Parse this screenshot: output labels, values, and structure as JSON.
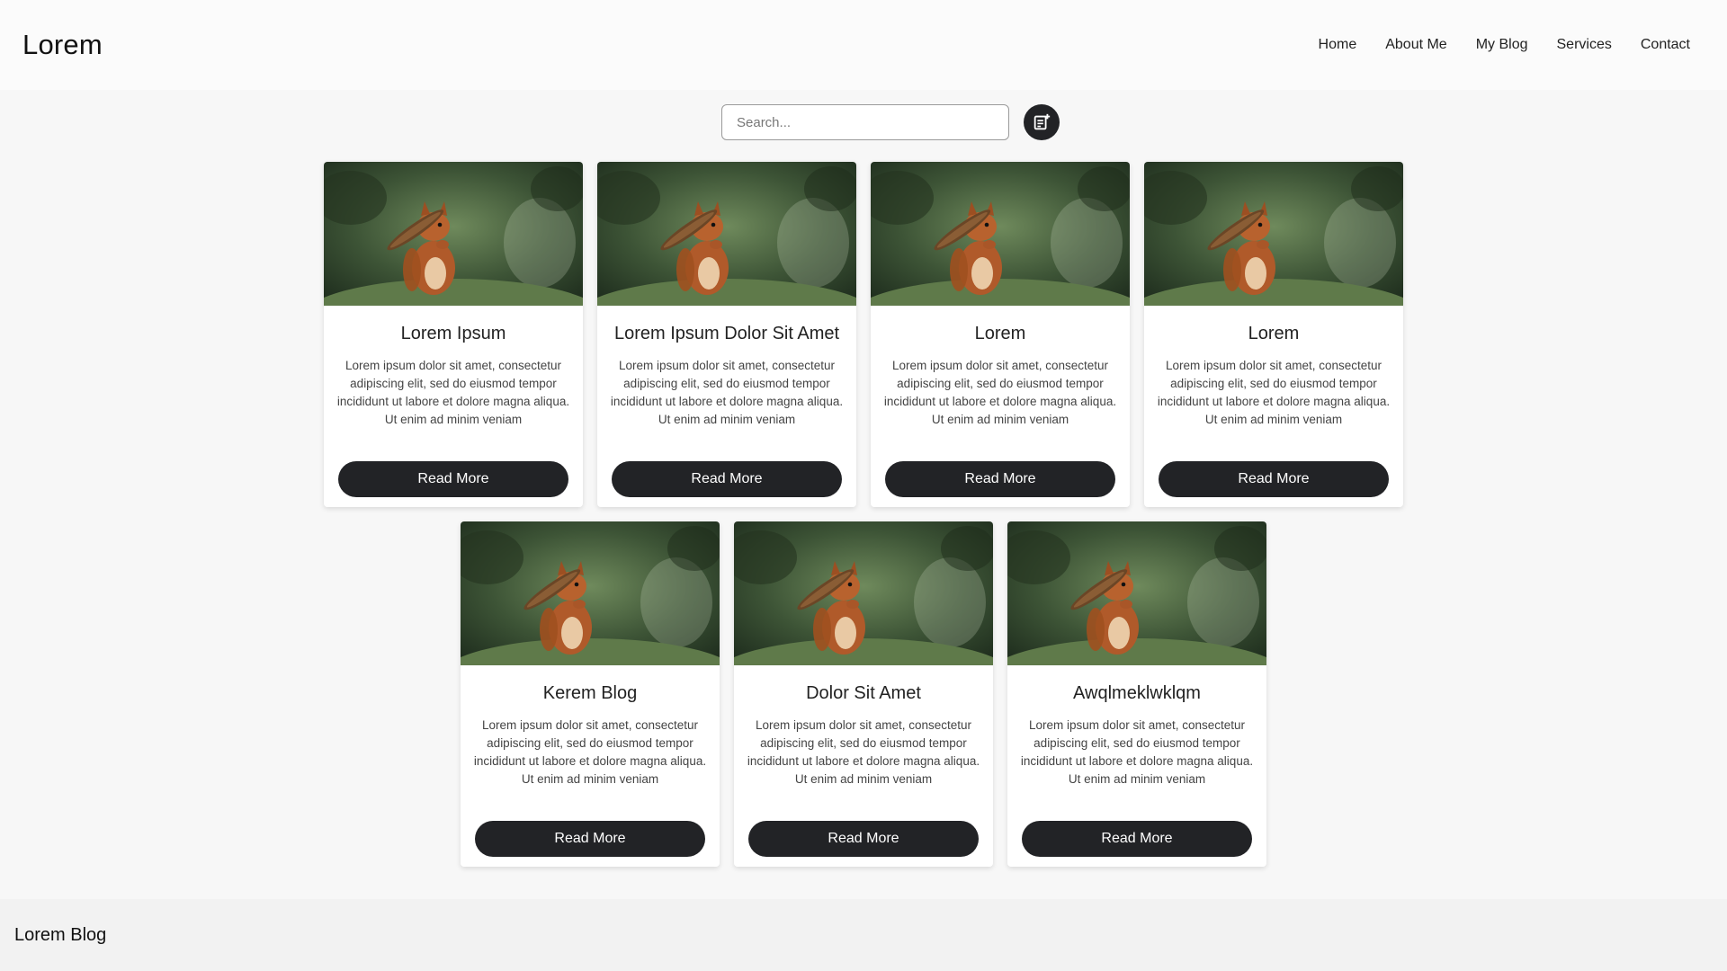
{
  "header": {
    "brand": "Lorem",
    "nav": [
      {
        "label": "Home"
      },
      {
        "label": "About Me"
      },
      {
        "label": "My Blog"
      },
      {
        "label": "Services"
      },
      {
        "label": "Contact"
      }
    ]
  },
  "search": {
    "placeholder": "Search...",
    "value": "",
    "add_icon": "add-note-icon"
  },
  "cards": [
    {
      "title": "Lorem Ipsum",
      "text": "Lorem ipsum dolor sit amet, consectetur adipiscing elit, sed do eiusmod tempor incididunt ut labore et dolore magna aliqua. Ut enim ad minim veniam",
      "button": "Read More"
    },
    {
      "title": "Lorem Ipsum Dolor Sit Amet",
      "text": "Lorem ipsum dolor sit amet, consectetur adipiscing elit, sed do eiusmod tempor incididunt ut labore et dolore magna aliqua. Ut enim ad minim veniam",
      "button": "Read More"
    },
    {
      "title": "Lorem",
      "text": "Lorem ipsum dolor sit amet, consectetur adipiscing elit, sed do eiusmod tempor incididunt ut labore et dolore magna aliqua. Ut enim ad minim veniam",
      "button": "Read More"
    },
    {
      "title": "Lorem",
      "text": "Lorem ipsum dolor sit amet, consectetur adipiscing elit, sed do eiusmod tempor incididunt ut labore et dolore magna aliqua. Ut enim ad minim veniam",
      "button": "Read More"
    },
    {
      "title": "Kerem Blog",
      "text": "Lorem ipsum dolor sit amet, consectetur adipiscing elit, sed do eiusmod tempor incididunt ut labore et dolore magna aliqua. Ut enim ad minim veniam",
      "button": "Read More"
    },
    {
      "title": "Dolor Sit Amet",
      "text": "Lorem ipsum dolor sit amet, consectetur adipiscing elit, sed do eiusmod tempor incididunt ut labore et dolore magna aliqua. Ut enim ad minim veniam",
      "button": "Read More"
    },
    {
      "title": "Awqlmeklwklqm",
      "text": "Lorem ipsum dolor sit amet, consectetur adipiscing elit, sed do eiusmod tempor incididunt ut labore et dolore magna aliqua. Ut enim ad minim veniam",
      "button": "Read More"
    }
  ],
  "footer": {
    "text": "Lorem Blog"
  },
  "colors": {
    "dark": "#222326",
    "page_bg": "#f7f7f7",
    "card_bg": "#ffffff"
  }
}
